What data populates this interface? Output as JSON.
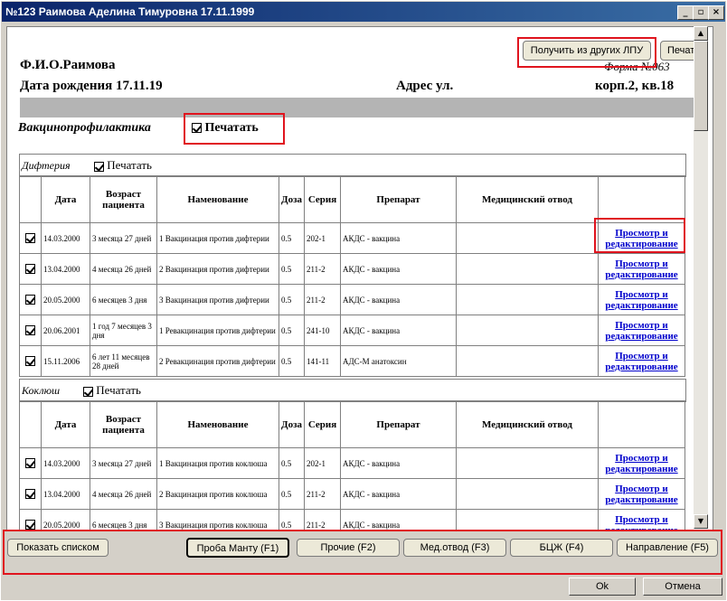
{
  "window": {
    "title": "№123 Раимова Аделина Тимуровна 17.11.1999",
    "min": "_",
    "restore": "▫",
    "close": "×"
  },
  "toolbar": {
    "get_other_label": "Получить из других ЛПУ",
    "print_label": "Печать"
  },
  "header": {
    "fio": "Ф.И.О.Раимова",
    "form": "Форма №063",
    "dob": "Дата рождения 17.11.19",
    "address": "Адрес ул.",
    "corp": "корп.2, кв.18"
  },
  "vaccination": {
    "title": "Вакцинопрофилактика",
    "print_label": "Печатать"
  },
  "columns": [
    "Дата",
    "Возраст пациента",
    "Наменование",
    "Доза",
    "Серия",
    "Препарат",
    "Медицинский отвод"
  ],
  "link_label": "Просмотр и редактирование",
  "sections": [
    {
      "name": "Дифтерия",
      "print_label": "Печатать",
      "rows": [
        {
          "date": "14.03.2000",
          "age": "3 месяца 27 дней",
          "name": "1 Вакцинация против дифтерии",
          "dose": "0.5",
          "series": "202-1",
          "drug": "АКДС - вакцина",
          "med": ""
        },
        {
          "date": "13.04.2000",
          "age": "4 месяца 26 дней",
          "name": "2 Вакцинация против дифтерии",
          "dose": "0.5",
          "series": "211-2",
          "drug": "АКДС - вакцина",
          "med": ""
        },
        {
          "date": "20.05.2000",
          "age": "6 месяцев 3 дня",
          "name": "3 Вакцинация против дифтерии",
          "dose": "0.5",
          "series": "211-2",
          "drug": "АКДС - вакцина",
          "med": ""
        },
        {
          "date": "20.06.2001",
          "age": "1 год 7 месяцев 3 дня",
          "name": "1 Ревакцинация против дифтерии",
          "dose": "0.5",
          "series": "241-10",
          "drug": "АКДС - вакцина",
          "med": ""
        },
        {
          "date": "15.11.2006",
          "age": "6 лет 11 месяцев 28 дней",
          "name": "2 Ревакцинация против дифтерии",
          "dose": "0.5",
          "series": "141-11",
          "drug": "АДС-М анатоксин",
          "med": ""
        }
      ]
    },
    {
      "name": "Коклюш",
      "print_label": "Печатать",
      "rows": [
        {
          "date": "14.03.2000",
          "age": "3 месяца 27 дней",
          "name": "1 Вакцинация против коклюша",
          "dose": "0.5",
          "series": "202-1",
          "drug": "АКДС - вакцина",
          "med": ""
        },
        {
          "date": "13.04.2000",
          "age": "4 месяца 26 дней",
          "name": "2 Вакцинация против коклюша",
          "dose": "0.5",
          "series": "211-2",
          "drug": "АКДС - вакцина",
          "med": ""
        },
        {
          "date": "20.05.2000",
          "age": "6 месяцев 3 дня",
          "name": "3 Вакцинация против коклюша",
          "dose": "0.5",
          "series": "211-2",
          "drug": "АКДС - вакцина",
          "med": ""
        }
      ]
    }
  ],
  "bottom": {
    "list_label": "Показать списком",
    "mantoux_label": "Проба Манту (F1)",
    "other_label": "Прочие (F2)",
    "medotvod_label": "Мед.отвод (F3)",
    "bcg_label": "БЦЖ (F4)",
    "direction_label": "Направление (F5)",
    "ok_label": "Ok",
    "cancel_label": "Отмена"
  }
}
